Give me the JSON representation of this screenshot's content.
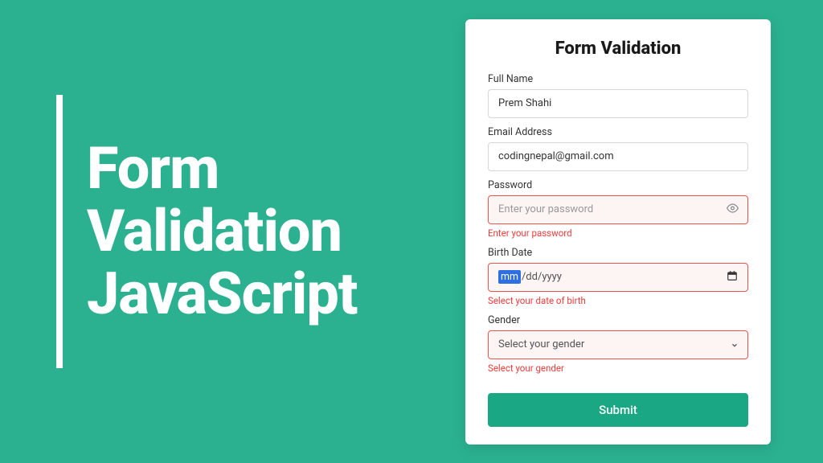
{
  "hero": {
    "line1": "Form",
    "line2": "Validation",
    "line3": "JavaScript"
  },
  "form": {
    "title": "Form Validation",
    "fullname": {
      "label": "Full Name",
      "value": "Prem Shahi"
    },
    "email": {
      "label": "Email Address",
      "value": "codingnepal@gmail.com"
    },
    "password": {
      "label": "Password",
      "placeholder": "Enter your password",
      "error": "Enter your password"
    },
    "birthdate": {
      "label": "Birth Date",
      "mm": "mm",
      "rest": "/dd/yyyy",
      "error": "Select your date of birth"
    },
    "gender": {
      "label": "Gender",
      "selected": "Select your gender",
      "error": "Select your gender"
    },
    "submit_label": "Submit"
  }
}
